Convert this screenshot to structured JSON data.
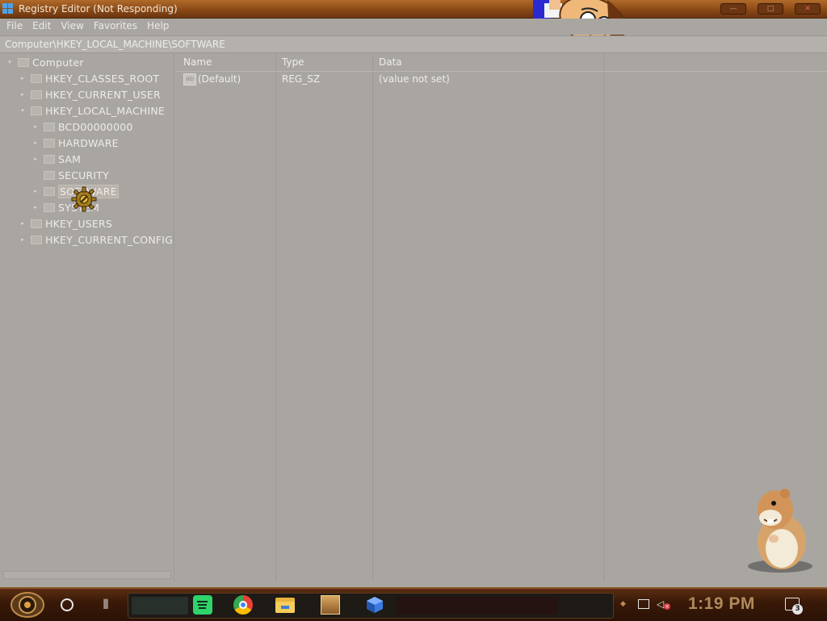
{
  "window": {
    "title": "Registry Editor (Not Responding)",
    "controls": {
      "minimize": "—",
      "maximize": "□",
      "close": "✕"
    }
  },
  "menu": [
    "File",
    "Edit",
    "View",
    "Favorites",
    "Help"
  ],
  "address": "Computer\\HKEY_LOCAL_MACHINE\\SOFTWARE",
  "tree": [
    {
      "label": "Computer",
      "level": 0,
      "expanded": true
    },
    {
      "label": "HKEY_CLASSES_ROOT",
      "level": 1,
      "expanded": false
    },
    {
      "label": "HKEY_CURRENT_USER",
      "level": 1,
      "expanded": false
    },
    {
      "label": "HKEY_LOCAL_MACHINE",
      "level": 1,
      "expanded": true
    },
    {
      "label": "BCD00000000",
      "level": 2,
      "expanded": false
    },
    {
      "label": "HARDWARE",
      "level": 2,
      "expanded": false
    },
    {
      "label": "SAM",
      "level": 2,
      "expanded": false
    },
    {
      "label": "SECURITY",
      "level": 2,
      "expanded": false,
      "noarrow": true
    },
    {
      "label": "SOFTWARE",
      "level": 2,
      "expanded": false,
      "selected": true
    },
    {
      "label": "SYSTEM",
      "level": 2,
      "expanded": false
    },
    {
      "label": "HKEY_USERS",
      "level": 1,
      "expanded": false
    },
    {
      "label": "HKEY_CURRENT_CONFIG",
      "level": 1,
      "expanded": false
    }
  ],
  "columns": {
    "name": "Name",
    "type": "Type",
    "data": "Data"
  },
  "values": [
    {
      "icon": "ab",
      "name": "(Default)",
      "type": "REG_SZ",
      "data": "(value not set)"
    }
  ],
  "taskbar": {
    "time": "1:19 PM",
    "notification_count": "3",
    "pinned": [
      "cortana-icon",
      "task-view-icon",
      "spotify-icon",
      "chrome-icon",
      "file-explorer-icon",
      "game-box-icon",
      "cube-app-icon"
    ]
  },
  "colors": {
    "titlebar": "#8a4a16",
    "window_bg": "#a9a6a2",
    "taskbar": "#2a1206",
    "clock": "#b08a5c"
  }
}
